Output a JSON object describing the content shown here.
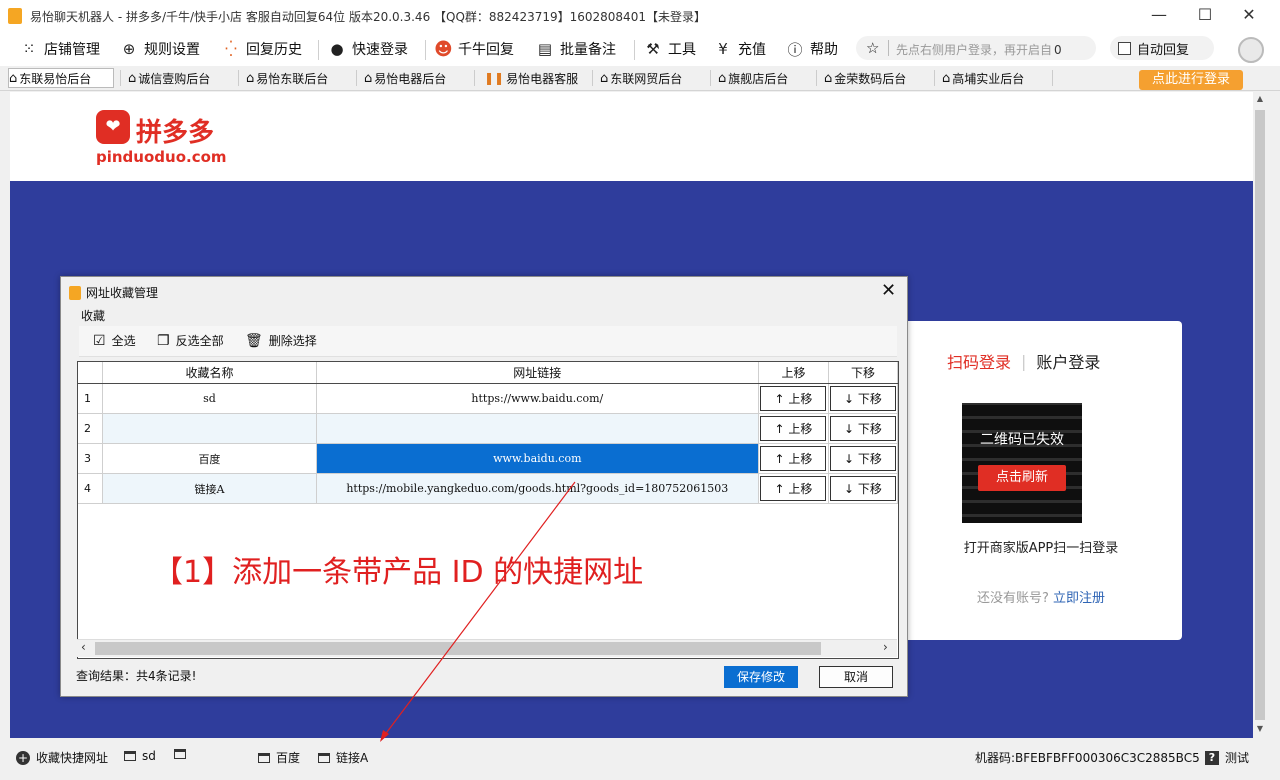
{
  "window": {
    "title": "易怡聊天机器人 - 拼多多/千牛/快手小店 客服自动回复64位 版本20.0.3.46 【QQ群：882423719】1602808401【未登录】",
    "minimize": "—",
    "maximize": "☐",
    "close": "✕"
  },
  "menu": {
    "items": [
      {
        "icon": "grid-icon",
        "glyph": "⁙",
        "label": "店铺管理"
      },
      {
        "icon": "globe-icon",
        "glyph": "⊕",
        "label": "规则设置"
      },
      {
        "icon": "dots-icon",
        "glyph": "⁛",
        "label": "回复历史"
      },
      {
        "icon": "user-icon",
        "glyph": "●",
        "label": "快速登录"
      },
      {
        "icon": "qianniu-icon",
        "glyph": "☻",
        "label": "千牛回复"
      },
      {
        "icon": "batch-icon",
        "glyph": "▤",
        "label": "批量备注"
      },
      {
        "icon": "wrench-icon",
        "glyph": "🔧",
        "label": "工具"
      },
      {
        "icon": "yen-icon",
        "glyph": "¥",
        "label": "充值"
      },
      {
        "icon": "info-icon",
        "glyph": "ⓘ",
        "label": "帮助"
      }
    ],
    "search_placeholder": "先点右侧用户登录，再开启自",
    "search_suffix": "0",
    "auto_reply": "自动回复"
  },
  "tabs": [
    "东联易怡后台",
    "诚信壹购后台",
    "易怡东联后台",
    "易怡电器后台",
    "易怡电器客服",
    "东联网贸后台",
    "旗舰店后台",
    "金荣数码后台",
    "高埔实业后台"
  ],
  "login_button": "点此进行登录",
  "pdd": {
    "brand": "拼多多",
    "domain": "pinduoduo.com",
    "tab_qr": "扫码登录",
    "tab_account": "账户登录",
    "qr_expired": "二维码已失效",
    "qr_refresh": "点击刷新",
    "scan_hint": "打开商家版APP扫一扫登录",
    "no_account": "还没有账号?",
    "register": "立即注册"
  },
  "dialog": {
    "title": "网址收藏管理",
    "group": "收藏",
    "select_all": "全选",
    "invert": "反选全部",
    "delete": "删除选择",
    "columns": [
      "",
      "收藏名称",
      "网址链接",
      "上移",
      "下移"
    ],
    "rows": [
      {
        "no": "1",
        "name": "sd",
        "url": "https://www.baidu.com/"
      },
      {
        "no": "2",
        "name": "",
        "url": ""
      },
      {
        "no": "3",
        "name": "百度",
        "url": "www.baidu.com"
      },
      {
        "no": "4",
        "name": "链接A",
        "url": "https://mobile.yangkeduo.com/goods.html?goods_id=180752061503"
      }
    ],
    "up_label": "↑ 上移",
    "down_label": "↓ 下移",
    "annotation": "【1】添加一条带产品 ID 的快捷网址",
    "status": "查询结果：共4条记录!",
    "save": "保存修改",
    "cancel": "取消"
  },
  "bottom": {
    "add_fav": "收藏快捷网址",
    "favs": [
      "sd",
      "",
      "百度",
      "链接A"
    ],
    "machine_code": "机器码:BFEBFBFF000306C3C2885BC5",
    "test": "测试"
  },
  "colors": {
    "pdd_red": "#e02e24",
    "banner_blue": "#2f3d9c",
    "select_blue": "#0a6ed1",
    "login_orange": "#f5a030",
    "annotation_red": "#e02020"
  }
}
